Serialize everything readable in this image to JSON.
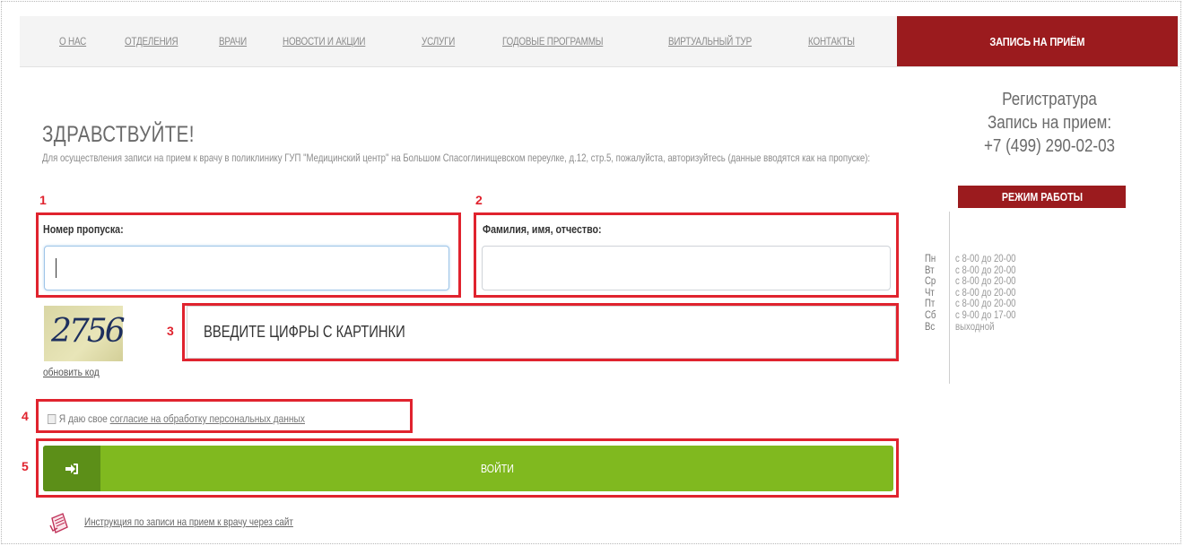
{
  "nav": {
    "items": [
      "О НАС",
      "ОТДЕЛЕНИЯ",
      "ВРАЧИ",
      "НОВОСТИ И АКЦИИ",
      "УСЛУГИ",
      "ГОДОВЫЕ ПРОГРАММЫ",
      "ВИРТУАЛЬНЫЙ ТУР",
      "КОНТАКТЫ"
    ],
    "cta": "ЗАПИСЬ НА ПРИЁМ"
  },
  "page": {
    "title": "ЗДРАВСТВУЙТЕ!",
    "intro": "Для осуществления записи на прием к врачу в поликлинику ГУП \"Медицинский центр\" на Большом Спасоглинищевском переулке, д.12, стр.5, пожалуйста, авторизуйтесь (данные вводятся как на пропуске):"
  },
  "markers": [
    "1",
    "2",
    "3",
    "4",
    "5"
  ],
  "form": {
    "pass_label": "Номер пропуска:",
    "pass_value": "",
    "name_label": "Фамилия, имя, отчество:",
    "name_value": "",
    "captcha_text": "2756",
    "refresh_label": "обновить код",
    "captcha_placeholder": "ВВЕДИТЕ ЦИФРЫ С КАРТИНКИ",
    "consent_prefix": "Я даю свое",
    "consent_link": "согласие на обработку персональных данных",
    "login_label": "ВОЙТИ",
    "login_icon": "sign-in-icon",
    "instruction_link": "Инструкция по записи на прием к врачу через сайт",
    "instruction_icon": "document-icon"
  },
  "sidebar": {
    "reg_title": "Регистратура",
    "reg_subtitle": "Запись на прием:",
    "phone": "+7 (499) 290-02-03",
    "mode_label": "РЕЖИМ РАБОТЫ",
    "schedule": [
      {
        "day": "Пн",
        "time": "с 8-00 до 20-00"
      },
      {
        "day": "Вт",
        "time": "с 8-00 до 20-00"
      },
      {
        "day": "Ср",
        "time": "с 8-00 до 20-00"
      },
      {
        "day": "Чт",
        "time": "с 8-00 до 20-00"
      },
      {
        "day": "Пт",
        "time": "с 8-00 до 20-00"
      },
      {
        "day": "Сб",
        "time": "с 9-00 до 17-00"
      },
      {
        "day": "Вс",
        "time": "выходной"
      }
    ]
  },
  "colors": {
    "brand_red": "#9b1b1e",
    "highlight_red": "#e0232e",
    "login_green": "#80b91f",
    "login_green_dark": "#5c8f18"
  }
}
